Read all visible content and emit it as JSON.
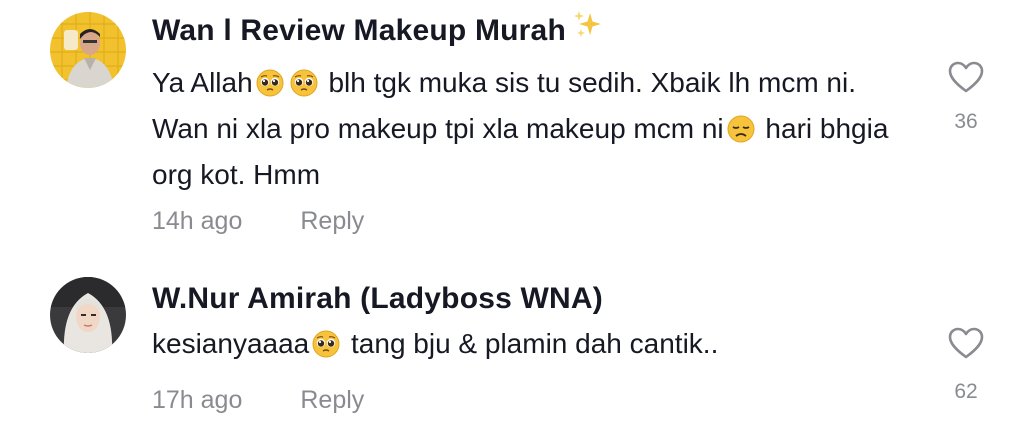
{
  "comments": [
    {
      "username": "Wan l Review Makeup Murah",
      "username_suffix_icon": "sparkles-emoji",
      "text_parts": [
        "Ya Allah",
        " blh tgk muka sis tu sedih. Xbaik lh mcm ni. Wan ni xla pro makeup tpi xla makeup mcm ni",
        " hari bhgia org kot. Hmm"
      ],
      "emojis": [
        "pleading-face-emoji",
        "pleading-face-emoji",
        "disappointed-face-emoji"
      ],
      "time": "14h ago",
      "reply_label": "Reply",
      "like_icon": "heart-outline-icon",
      "like_count": "36"
    },
    {
      "username": "W.Nur Amirah (Ladyboss WNA)",
      "text_parts": [
        "kesianyaaaa",
        " tang bju & plamin dah cantik.."
      ],
      "emojis": [
        "pleading-face-emoji"
      ],
      "time": "17h ago",
      "reply_label": "Reply",
      "like_icon": "heart-outline-icon",
      "like_count": "62"
    }
  ],
  "colors": {
    "text_primary": "#161823",
    "text_secondary": "#8a8b91",
    "background": "#ffffff"
  }
}
